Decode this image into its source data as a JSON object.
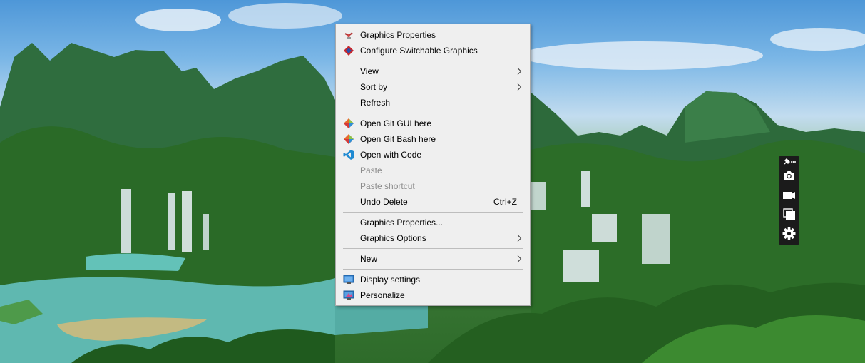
{
  "context_menu": {
    "items": [
      {
        "label": "Graphics Properties",
        "icon": "intel-graphics-icon"
      },
      {
        "label": "Configure Switchable Graphics",
        "icon": "amd-switchable-graphics-icon"
      },
      {
        "label": "View",
        "submenu": true
      },
      {
        "label": "Sort by",
        "submenu": true
      },
      {
        "label": "Refresh"
      },
      {
        "label": "Open Git GUI here",
        "icon": "git-icon"
      },
      {
        "label": "Open Git Bash here",
        "icon": "git-bash-icon"
      },
      {
        "label": "Open with Code",
        "icon": "vscode-icon"
      },
      {
        "label": "Paste",
        "disabled": true
      },
      {
        "label": "Paste shortcut",
        "disabled": true
      },
      {
        "label": "Undo Delete",
        "shortcut": "Ctrl+Z"
      },
      {
        "label": "Graphics Properties..."
      },
      {
        "label": "Graphics Options",
        "submenu": true
      },
      {
        "label": "New",
        "submenu": true
      },
      {
        "label": "Display settings",
        "icon": "display-icon"
      },
      {
        "label": "Personalize",
        "icon": "personalize-icon"
      }
    ]
  },
  "capture_bar": {
    "buttons": [
      "pin-icon",
      "camera-icon",
      "video-icon",
      "overlay-icon",
      "gear-icon"
    ]
  },
  "colors": {
    "menu_bg": "#efefef",
    "menu_text": "#000000",
    "menu_disabled": "#8c8c8c",
    "capture_bar_bg": "#1b1b1b"
  }
}
